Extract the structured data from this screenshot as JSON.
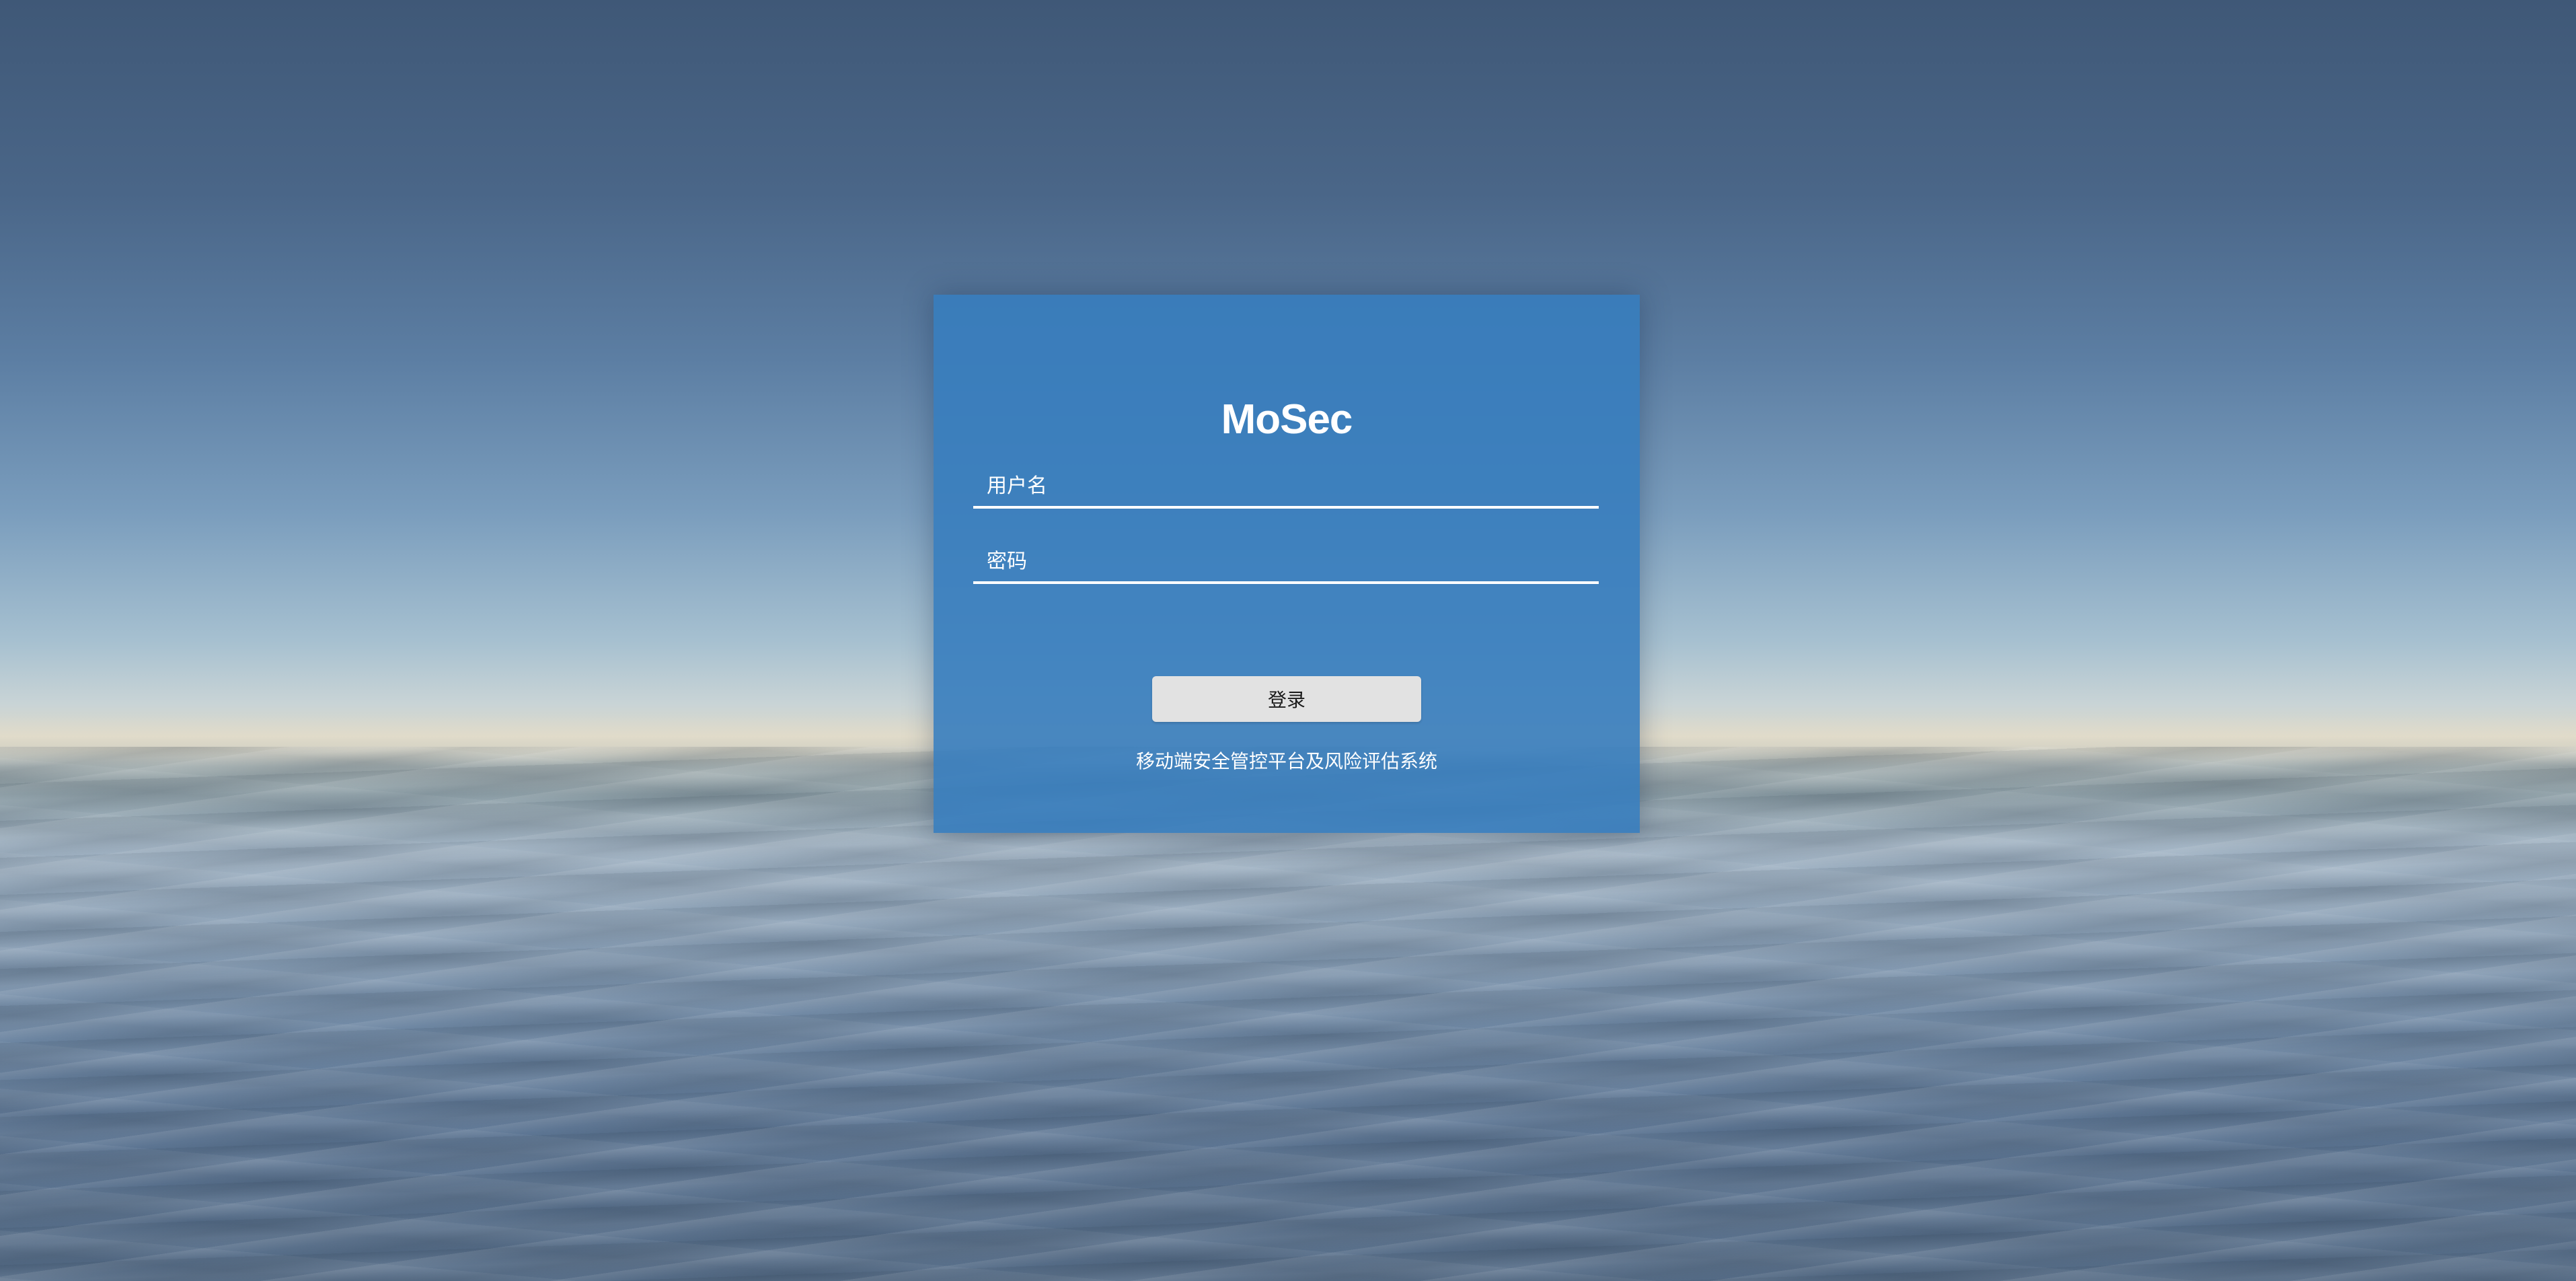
{
  "app": {
    "title": "MoSec",
    "subtitle": "移动端安全管控平台及风险评估系统"
  },
  "login_form": {
    "username": {
      "placeholder": "用户名",
      "value": ""
    },
    "password": {
      "placeholder": "密码",
      "value": ""
    },
    "submit_label": "登录"
  },
  "colors": {
    "card_background": "#377dbe",
    "button_background": "#e2e2e2",
    "text_primary": "#ffffff"
  }
}
